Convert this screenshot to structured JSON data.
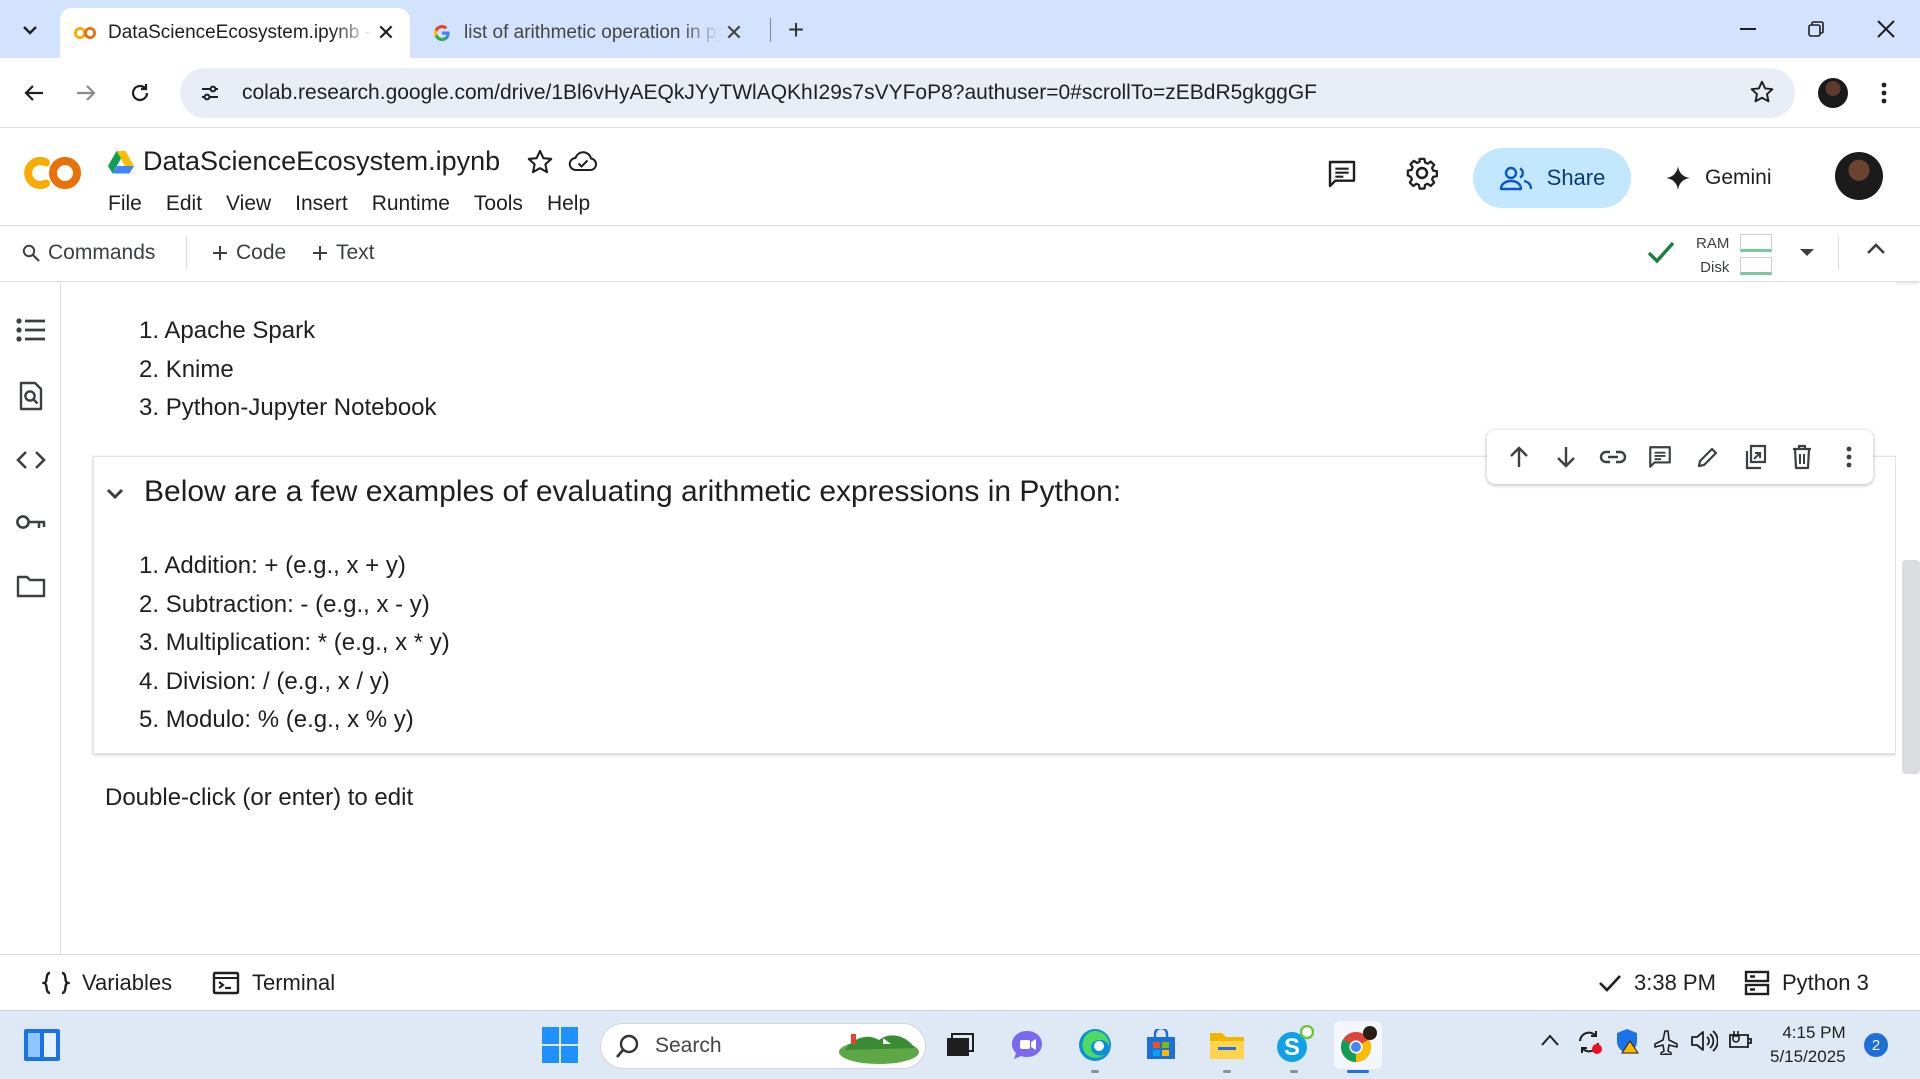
{
  "browser": {
    "tabs": [
      {
        "title": "DataScienceEcosystem.ipynb - Colab",
        "close": "✕"
      },
      {
        "title": "list of arithmetic operation in python - Google Search",
        "close": "✕"
      }
    ],
    "new_tab": "+",
    "url": "colab.research.google.com/drive/1Bl6vHyAEQkJYyTWlAQKhI29s7sVYFoP8?authuser=0#scrollTo=zEBdR5gkggGF"
  },
  "colab": {
    "logo": "CO",
    "notebook_title": "DataScienceEcosystem.ipynb",
    "menu": [
      "File",
      "Edit",
      "View",
      "Insert",
      "Runtime",
      "Tools",
      "Help"
    ],
    "share_label": "Share",
    "gemini_label": "Gemini",
    "toolbar": {
      "commands": "Commands",
      "code": "Code",
      "text": "Text",
      "ram": "RAM",
      "disk": "Disk"
    }
  },
  "notebook": {
    "tools_list": [
      "Apache Spark",
      "Knime",
      "Python-Jupyter Notebook"
    ],
    "cell": {
      "heading": "Below are a few examples of evaluating arithmetic expressions in Python:",
      "items": [
        "Addition: + (e.g., x + y)",
        "Subtraction: - (e.g., x - y)",
        "Multiplication: * (e.g., x * y)",
        "Division: / (e.g., x / y)",
        "Modulo: % (e.g., x % y)"
      ]
    },
    "hint": "Double-click (or enter) to edit"
  },
  "status_bar": {
    "variables": "Variables",
    "terminal": "Terminal",
    "last_run": "3:38 PM",
    "runtime": "Python 3"
  },
  "taskbar": {
    "search_placeholder": "Search",
    "time": "4:15 PM",
    "date": "5/15/2025",
    "notifications": "2"
  },
  "colors": {
    "tab_strip": "#d3e3fd",
    "share_bg": "#c2e7ff",
    "colab_orange": "#f9ab00",
    "colab_orange_dark": "#e8710a",
    "connected_green": "#188038"
  }
}
